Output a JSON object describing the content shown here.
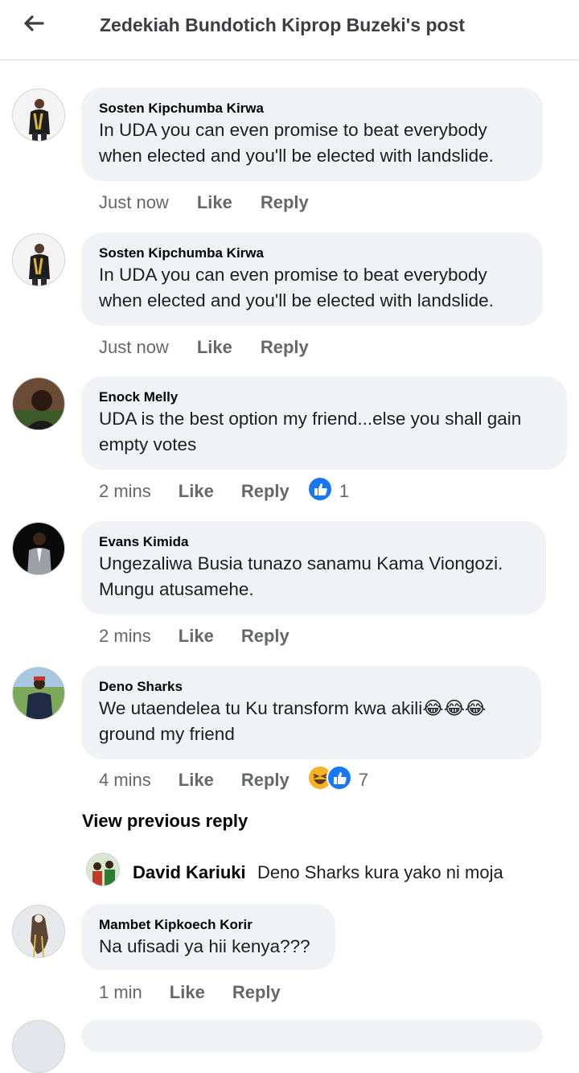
{
  "header": {
    "title": "Zedekiah Bundotich Kiprop Buzeki's post"
  },
  "comments": [
    {
      "author": "Sosten Kipchumba Kirwa",
      "text": "In UDA you can even promise to beat everybody when elected and you'll be elected with landslide.",
      "time": "Just now",
      "like": "Like",
      "reply": "Reply"
    },
    {
      "author": "Sosten Kipchumba Kirwa",
      "text": "In UDA you can even promise to beat everybody when elected and you'll be elected with landslide.",
      "time": "Just now",
      "like": "Like",
      "reply": "Reply"
    },
    {
      "author": "Enock Melly",
      "text": "UDA is the best option my friend...else you shall gain empty votes",
      "time": "2 mins",
      "like": "Like",
      "reply": "Reply",
      "reactions": {
        "count": "1",
        "icons": [
          "like-reaction-icon"
        ]
      }
    },
    {
      "author": "Evans Kimida",
      "text": "Ungezaliwa Busia tunazo sanamu Kama Viongozi. Mungu atusamehe.",
      "time": "2 mins",
      "like": "Like",
      "reply": "Reply"
    },
    {
      "author": "Deno Sharks",
      "text": "We utaendelea tu Ku transform kwa akili😂😂😂 ground my friend",
      "time": "4 mins",
      "like": "Like",
      "reply": "Reply",
      "reactions": {
        "count": "7",
        "icons": [
          "haha-reaction-icon",
          "like-reaction-icon"
        ]
      }
    },
    {
      "author": "Mambet Kipkoech Korir",
      "text": "Na ufisadi ya hii kenya???",
      "time": "1 min",
      "like": "Like",
      "reply": "Reply"
    }
  ],
  "view_previous_reply": "View previous reply",
  "reply_preview": {
    "author": "David Kariuki",
    "text": "Deno Sharks kura yako ni moja"
  },
  "colors": {
    "bubble": "#f0f2f5",
    "secondary_text": "#65676b",
    "like_blue": "#1877f2",
    "haha_yellow": "#f7b125"
  }
}
